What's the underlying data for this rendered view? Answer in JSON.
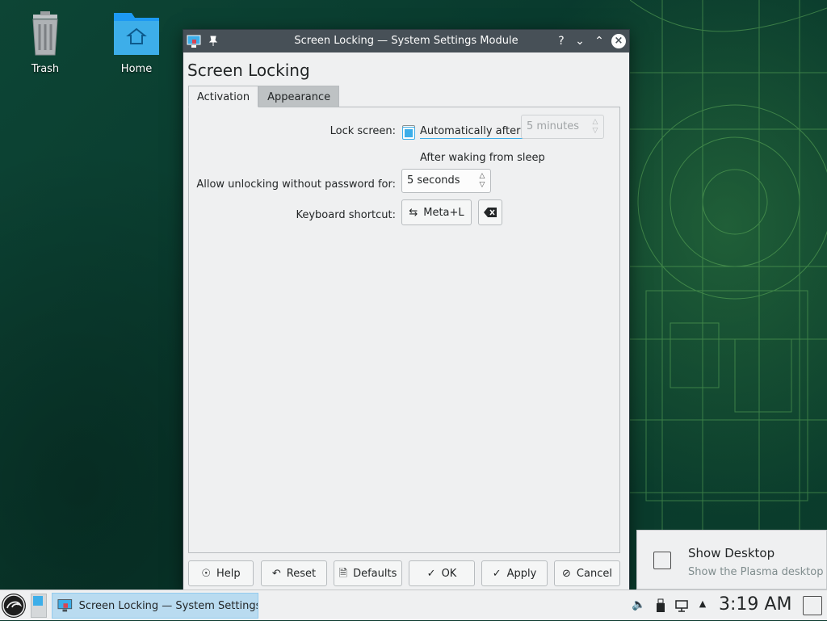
{
  "desktop": {
    "icons": [
      {
        "label": "Trash",
        "icon": "trash-icon"
      },
      {
        "label": "Home",
        "icon": "home-folder-icon"
      }
    ]
  },
  "window": {
    "title": "Screen Locking — System Settings Module",
    "heading": "Screen Locking",
    "titlebar_buttons": [
      "help-icon",
      "minimize-icon",
      "maximize-icon",
      "close-icon"
    ],
    "tabs": [
      {
        "label": "Activation",
        "active": true
      },
      {
        "label": "Appearance",
        "active": false
      }
    ],
    "activation": {
      "lock_screen_label": "Lock screen:",
      "auto_label": "Automatically after:",
      "auto_checked": false,
      "auto_value": "5 minutes",
      "wake_label": "After waking from sleep",
      "wake_checked": true,
      "unlock_label": "Allow unlocking without password for:",
      "unlock_value": "5 seconds",
      "shortcut_label": "Keyboard shortcut:",
      "shortcut_value": "Meta+L"
    },
    "buttons": {
      "help": "Help",
      "reset": "Reset",
      "defaults": "Defaults",
      "ok": "OK",
      "apply": "Apply",
      "cancel": "Cancel"
    }
  },
  "tooltip": {
    "title": "Show Desktop",
    "subtitle": "Show the Plasma desktop"
  },
  "taskbar": {
    "task_label": "Screen Locking — System Settings...",
    "clock": "3:19 AM",
    "tray_icons": [
      "volume-icon",
      "usb-device-icon",
      "network-icon",
      "expand-tray-icon"
    ]
  },
  "colors": {
    "accent": "#3daee9",
    "titlebar": "#475057",
    "window_bg": "#eff0f1"
  }
}
